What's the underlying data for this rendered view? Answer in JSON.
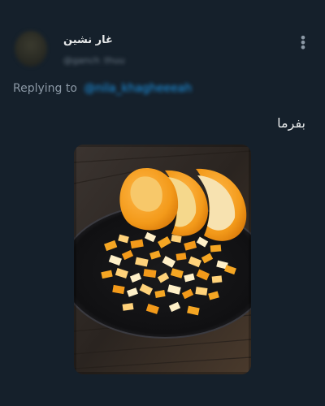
{
  "author": {
    "name": "غار نشین",
    "handle": "@ganch_thuu"
  },
  "reply": {
    "label": "Replying to",
    "target": "@nila_khagheeeah"
  },
  "tweet": {
    "text": "بفرما"
  },
  "icons": {
    "more": "more-vertical-icon"
  },
  "colors": {
    "background": "#15202b",
    "link": "#1d9bf0",
    "muted": "#8b98a5"
  }
}
